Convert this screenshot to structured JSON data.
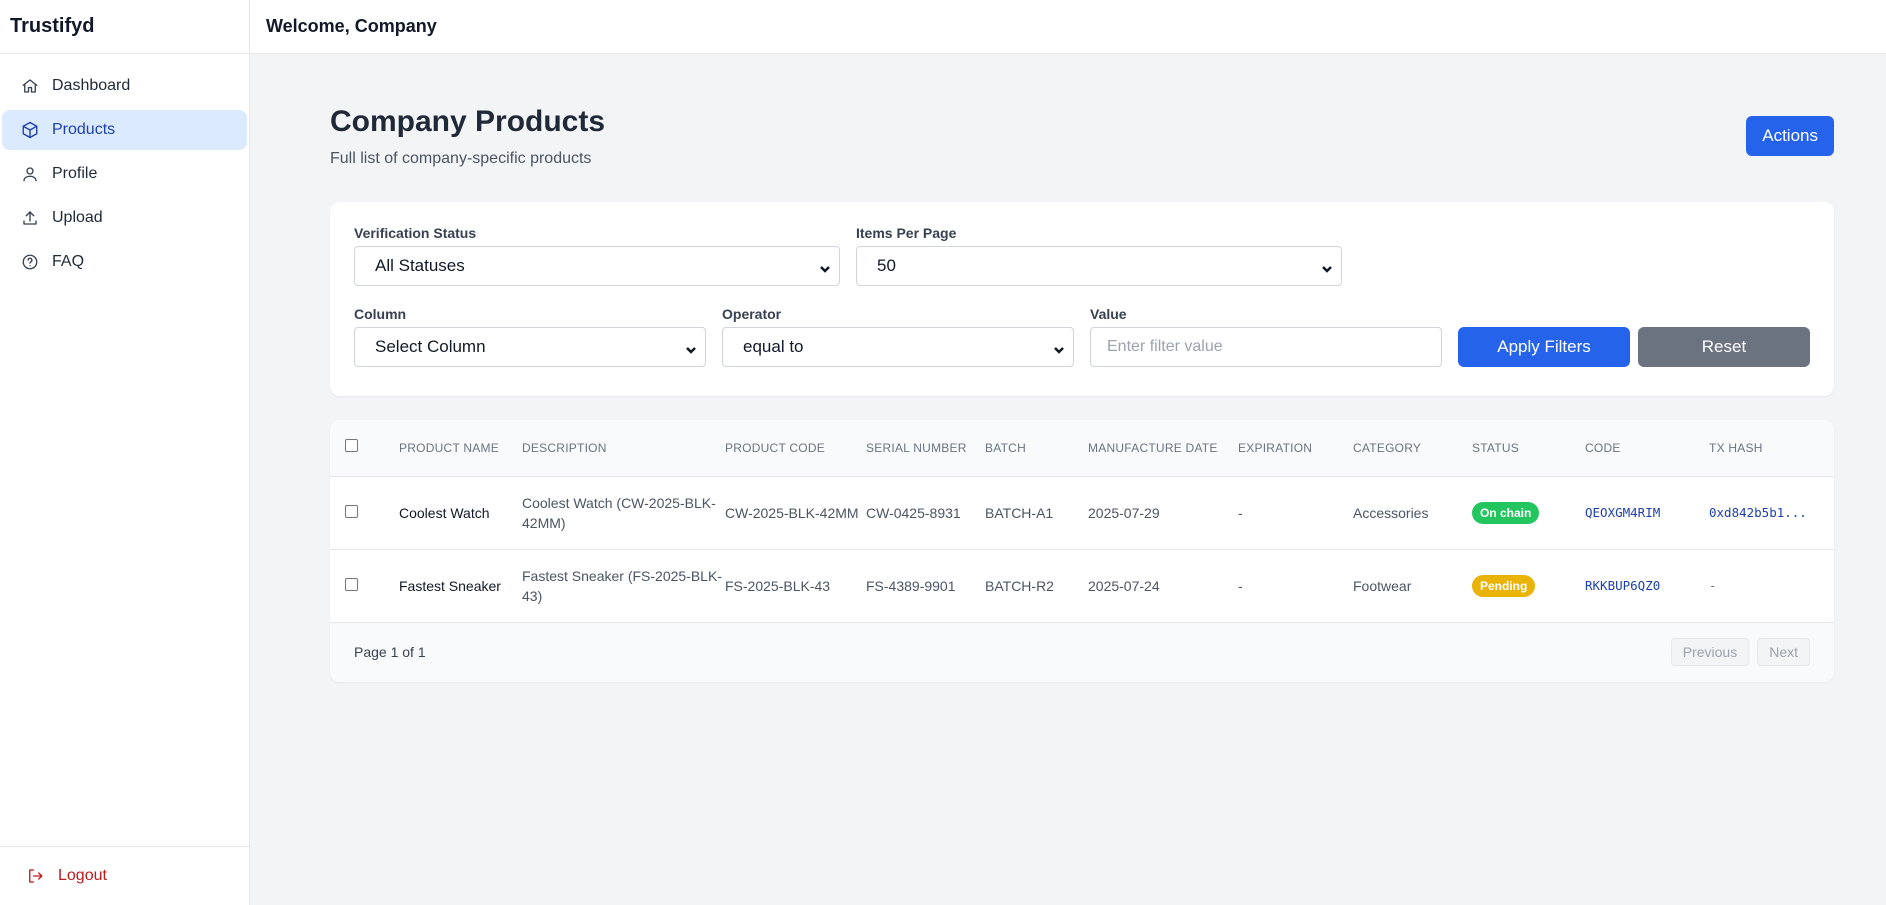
{
  "app": {
    "brand": "Trustifyd"
  },
  "sidebar": {
    "items": [
      {
        "label": "Dashboard",
        "icon": "home-icon",
        "active": false
      },
      {
        "label": "Products",
        "icon": "cube-icon",
        "active": true
      },
      {
        "label": "Profile",
        "icon": "user-icon",
        "active": false
      },
      {
        "label": "Upload",
        "icon": "upload-icon",
        "active": false
      },
      {
        "label": "FAQ",
        "icon": "help-circle-icon",
        "active": false
      }
    ],
    "logout_label": "Logout"
  },
  "topbar": {
    "welcome": "Welcome, Company"
  },
  "page": {
    "title": "Company Products",
    "subtitle": "Full list of company-specific products",
    "actions_label": "Actions"
  },
  "filters": {
    "verification_status": {
      "label": "Verification Status",
      "value": "All Statuses"
    },
    "items_per_page": {
      "label": "Items Per Page",
      "value": "50"
    },
    "column": {
      "label": "Column",
      "value": "Select Column"
    },
    "operator": {
      "label": "Operator",
      "value": "equal to"
    },
    "value": {
      "label": "Value",
      "placeholder": "Enter filter value"
    },
    "apply_label": "Apply Filters",
    "reset_label": "Reset"
  },
  "table": {
    "headers": [
      "PRODUCT NAME",
      "DESCRIPTION",
      "PRODUCT CODE",
      "SERIAL NUMBER",
      "BATCH",
      "MANUFACTURE DATE",
      "EXPIRATION",
      "CATEGORY",
      "STATUS",
      "CODE",
      "TX HASH"
    ],
    "rows": [
      {
        "name": "Coolest Watch",
        "description": "Coolest Watch (CW-2025-BLK-42MM)",
        "product_code": "CW-2025-BLK-42MM",
        "serial": "CW-0425-8931",
        "batch": "BATCH-A1",
        "manufacture_date": "2025-07-29",
        "expiration": "-",
        "category": "Accessories",
        "status": "On chain",
        "status_color": "#22c55e",
        "code": "QEOXGM4RIM",
        "tx_hash": "0xd842b5b1..."
      },
      {
        "name": "Fastest Sneaker",
        "description": "Fastest Sneaker (FS-2025-BLK-43)",
        "product_code": "FS-2025-BLK-43",
        "serial": "FS-4389-9901",
        "batch": "BATCH-R2",
        "manufacture_date": "2025-07-24",
        "expiration": "-",
        "category": "Footwear",
        "status": "Pending",
        "status_color": "#eab308",
        "code": "RKKBUP6QZ0",
        "tx_hash": "-"
      }
    ]
  },
  "pagination": {
    "info": "Page 1 of 1",
    "prev_label": "Previous",
    "next_label": "Next"
  },
  "colors": {
    "primary": "#2563eb",
    "active_nav_bg": "#dbeafe",
    "danger": "#b91c1c",
    "reset_gray": "#6b7280"
  }
}
